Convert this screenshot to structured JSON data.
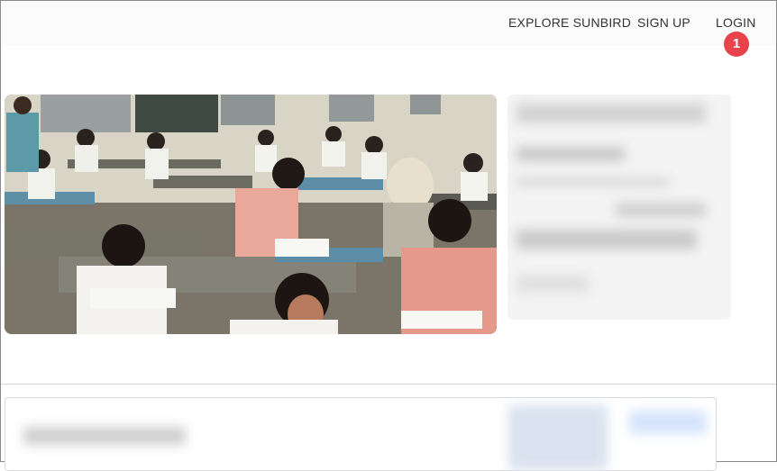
{
  "nav": {
    "explore_label": "EXPLORE SUNBIRD",
    "signup_label": "SIGN UP",
    "login_label": "LOGIN"
  },
  "annotation": {
    "badge_number": "1"
  },
  "colors": {
    "badge": "#e8434b",
    "topbar_bg": "#fbfbfb",
    "card_border": "#d9d9d9"
  }
}
